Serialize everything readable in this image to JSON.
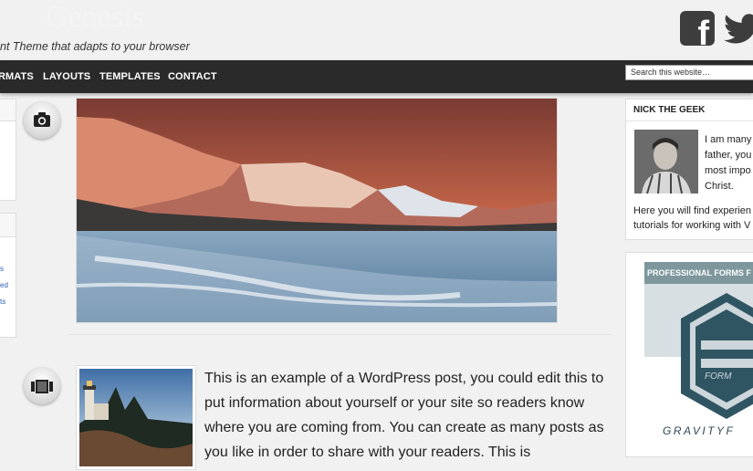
{
  "header": {
    "site_title_ghost": "Genesis",
    "tagline": "nt Theme that adapts to your browser",
    "social": [
      {
        "icon": "facebook-icon",
        "glyph": "f"
      },
      {
        "icon": "twitter-icon"
      }
    ]
  },
  "nav": {
    "items": [
      "RMATS",
      "LAYOUTS",
      "TEMPLATES",
      "CONTACT"
    ],
    "search_placeholder": "Search this website…"
  },
  "left_sidebar": {
    "links": [
      "s",
      "ed",
      "ts"
    ]
  },
  "posts": [
    {
      "format_icon": "camera-icon"
    },
    {
      "format_icon": "gallery-icon",
      "excerpt": "This is an example of a WordPress post, you could edit this to put information about yourself or your site so readers know where you are coming from. You can create as many posts as you like in order to share with your readers. This is"
    }
  ],
  "sidebar": {
    "author": {
      "title": "NICK THE GEEK",
      "bio_side": [
        "I am many",
        "father, you",
        "most impo",
        "Christ."
      ],
      "bio_bottom": [
        "Here you will find experien",
        "tutorials for working with V"
      ]
    },
    "ad": {
      "banner": "PROFESSIONAL FORMS F",
      "logo_word": "FORM",
      "brand": "GRAVITYF"
    }
  },
  "colors": {
    "nav_bg": "#2a2a2a",
    "ad_banner": "#7d979d",
    "link": "#2a5db0"
  }
}
